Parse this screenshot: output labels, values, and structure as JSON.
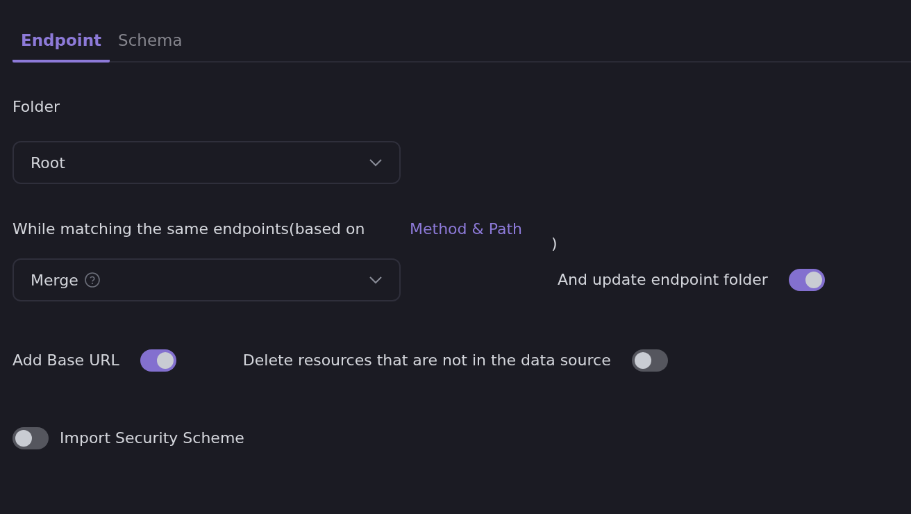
{
  "tabs": [
    {
      "label": "Endpoint",
      "selected": true
    },
    {
      "label": "Schema",
      "selected": false
    }
  ],
  "folder": {
    "label": "Folder",
    "value": "Root"
  },
  "matching": {
    "label": "While matching the same endpoints(based on",
    "link": "Method & Path",
    "suffix": ")",
    "select": {
      "value": "Merge"
    },
    "update_folder": {
      "label": "And update endpoint folder",
      "on": true
    }
  },
  "options": [
    {
      "label": "Add Base URL",
      "on": true
    },
    {
      "label": "Delete resources that are not in the data source",
      "on": false
    }
  ],
  "import_security": {
    "label": "Import Security Scheme",
    "on": false
  }
}
